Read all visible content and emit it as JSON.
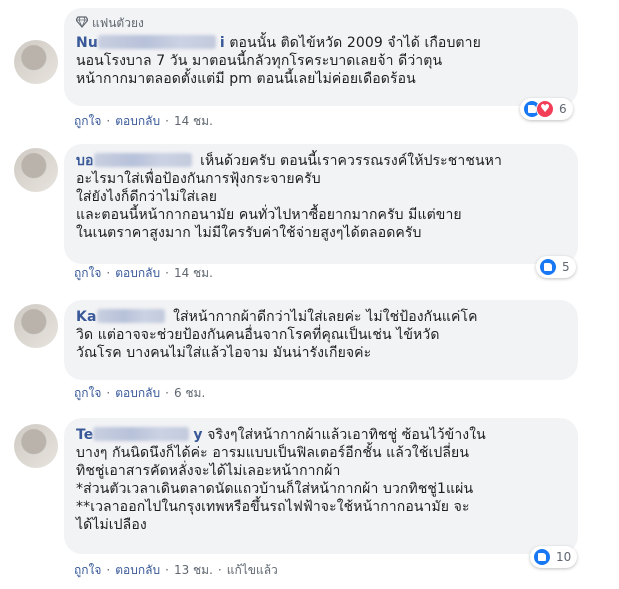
{
  "comments": [
    {
      "badge": "แฟนตัวยง",
      "name": "Nu",
      "name_tail": "i",
      "text": "ตอนนั้น ติดไข้หวัด 2009 จำได้ เกือบตาย\nนอนโรงบาล 7 วัน มาตอนนี้กลัวทุกโรคระบาดเลยจ้า ดีว่าตุน\nหน้ากากมาตลอดตั้งแต่มี pm ตอนนี้เลยไม่ค่อยเดือดร้อน",
      "reaction_count": "6",
      "actions": {
        "like": "ถูกใจ",
        "reply": "ตอบกลับ",
        "time": "14 ชม."
      }
    },
    {
      "name": "บอ",
      "text": "เห็นด้วยครับ ตอนนี้เราควรรณรงค์ให้ประชาชนหา\nอะไรมาใส่เพื่อป้องกันการฟุ้งกระจายครับ\nใส่ยังไงก็ดีกว่าไม่ใส่เลย\nและตอนนี้หน้ากากอนามัย คนทั่วไปหาซื้อยากมากครับ มีแต่ขาย\nในเนตราคาสูงมาก ไม่มีใครรับค่าใช้จ่ายสูงๆได้ตลอดครับ",
      "reaction_count": "5",
      "actions": {
        "like": "ถูกใจ",
        "reply": "ตอบกลับ",
        "time": "14 ชม."
      }
    },
    {
      "name": "Ka",
      "text": "ใส่หน้ากากผ้าดีกว่าไม่ใส่เลยค่ะ ไม่ใช่ป้องกันแค่โค\nวิด แต่อาจจะช่วยป้องกันคนอื่นจากโรคที่คุณเป็นเช่น ไข้หวัด\nวัณโรค บางคนไม่ใส่แล้วไอจาม มันน่ารังเกียจค่ะ",
      "actions": {
        "like": "ถูกใจ",
        "reply": "ตอบกลับ",
        "time": "6 ชม."
      }
    },
    {
      "name": "Te",
      "name_tail": "y",
      "text": "จริงๆใส่หน้ากากผ้าแล้วเอาทิชชู่ ซ้อนไว้ข้างใน\nบางๆ กันนิดนึงก็ได้ค่ะ อารมแบบเป็นฟิลเตอร์อีกชั้น แล้วใช้เปลี่ยน\nทิชชู่เอาสารคัดหลั่งจะได้ไม่เลอะหน้ากากผ้า\n*ส่วนตัวเวลาเดินตลาดนัดแถวบ้านก็ใส่หน้ากากผ้า บวกทิชชู่1แผ่น\n**เวลาออกไปในกรุงเทพหรือขึ้นรถไฟฟ้าจะใช้หน้ากากอนามัย จะ\nได้ไม่เปลือง",
      "reaction_count": "10",
      "actions": {
        "like": "ถูกใจ",
        "reply": "ตอบกลับ",
        "time": "13 ชม.",
        "edited": "แก้ไขแล้ว"
      }
    }
  ],
  "colors": {
    "bubble": "#f2f3f5",
    "link": "#385898",
    "meta": "#606770",
    "like": "#1877f2",
    "love": "#f33e58"
  },
  "icons": {
    "badge": "diamond-icon",
    "like": "like-reaction-icon",
    "love": "love-reaction-icon"
  }
}
